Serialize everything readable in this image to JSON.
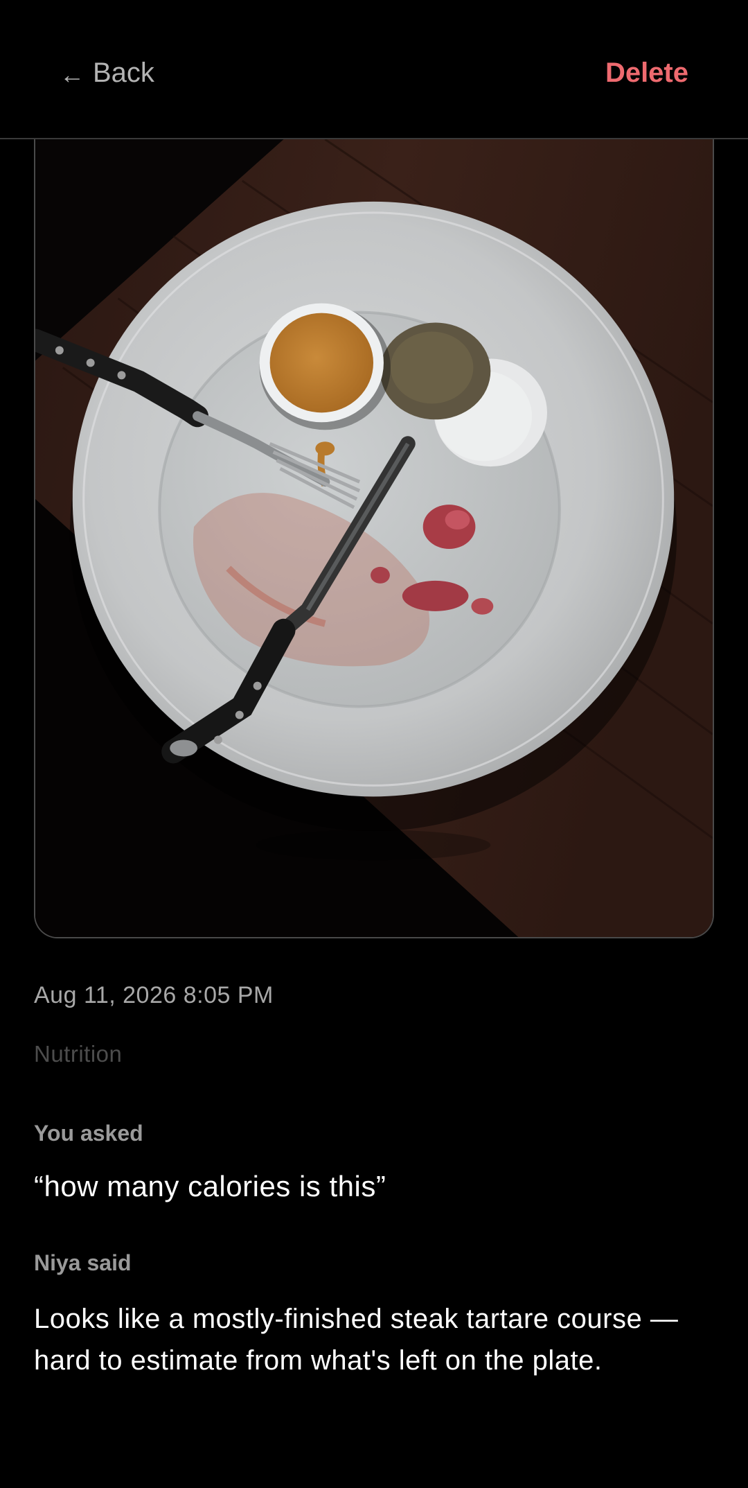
{
  "header": {
    "back_arrow": "←",
    "back_label": "Back",
    "delete_label": "Delete"
  },
  "photo": {
    "alt": "Mostly-finished steak tartare on a white plate with fork and knife"
  },
  "entry": {
    "timestamp": "Aug 11, 2026 8:05 PM",
    "category": "Nutrition"
  },
  "conversation": {
    "asked_label": "You asked",
    "asked_text": "“how many calories is this”",
    "said_label": "Niya said",
    "said_text": "Looks like a mostly-finished steak tartare course — hard to estimate from what's left on the plate."
  },
  "colors": {
    "background": "#000000",
    "delete_accent": "#ee6a6f",
    "secondary_text": "#b3b3b3",
    "muted_text": "#4d4d4d"
  },
  "icons": {
    "back": "arrow-left-icon"
  }
}
